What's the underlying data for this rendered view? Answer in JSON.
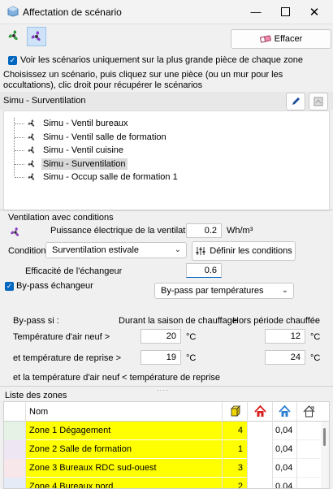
{
  "window": {
    "title": "Affectation de scénario"
  },
  "toolbar": {
    "clear_label": "Effacer"
  },
  "options": {
    "largest_room_label": "Voir les scénarios uniquement sur la plus grande pièce de chaque zone",
    "instructions": "Choisissez un scénario, puis cliquez sur une pièce (ou un mur pour les occultations), clic droit pour récupérer le scénarios"
  },
  "scenario_panel": {
    "current": "Simu - Surventilation",
    "items": [
      "Simu - Ventil bureaux",
      "Simu - Ventil salle de formation",
      "Simu - Ventil cuisine",
      "Simu - Surventilation",
      "Simu - Occup salle de formation 1"
    ],
    "selected_index": 3
  },
  "ventilation": {
    "section_title": "Ventilation avec conditions",
    "power_label": "Puissance électrique de la ventilation",
    "power_value": "0.2",
    "power_unit": "Wh/m³",
    "condition_label": "Condition",
    "condition_value": "Surventilation estivale",
    "define_button": "Définir les conditions",
    "efficiency_label": "Efficacité de l'échangeur",
    "efficiency_value": "0.6",
    "bypass_label": "By-pass échangeur",
    "bypass_mode": "By-pass par températures",
    "bypass_if": "By-pass si :",
    "heating_header": "Durant la saison de chauffage",
    "off_heating_header": "Hors période chauffée",
    "fresh_air_label": "Température d'air neuf >",
    "fresh_air_heating": "20",
    "fresh_air_off": "12",
    "return_label": "et température de reprise >",
    "return_heating": "19",
    "return_off": "24",
    "unit": "°C",
    "footer_condition": "et la température d'air neuf < température de reprise"
  },
  "zones": {
    "title": "Liste des zones",
    "name_header": "Nom",
    "rows": [
      {
        "name": "Zone 1 Dégagement",
        "count": "4",
        "value": "0,04",
        "color": "#e6f2e6"
      },
      {
        "name": "Zone 2 Salle de formation",
        "count": "1",
        "value": "0,04",
        "color": "#efe6f4"
      },
      {
        "name": "Zone 3 Bureaux RDC sud-ouest",
        "count": "3",
        "value": "0,04",
        "color": "#f7e6ea"
      },
      {
        "name": "Zone 4 Bureaux nord",
        "count": "2",
        "value": "0,04",
        "color": "#e6ecf7"
      }
    ]
  },
  "colors": {
    "accent": "#0067c0",
    "highlight": "#ffff00"
  }
}
